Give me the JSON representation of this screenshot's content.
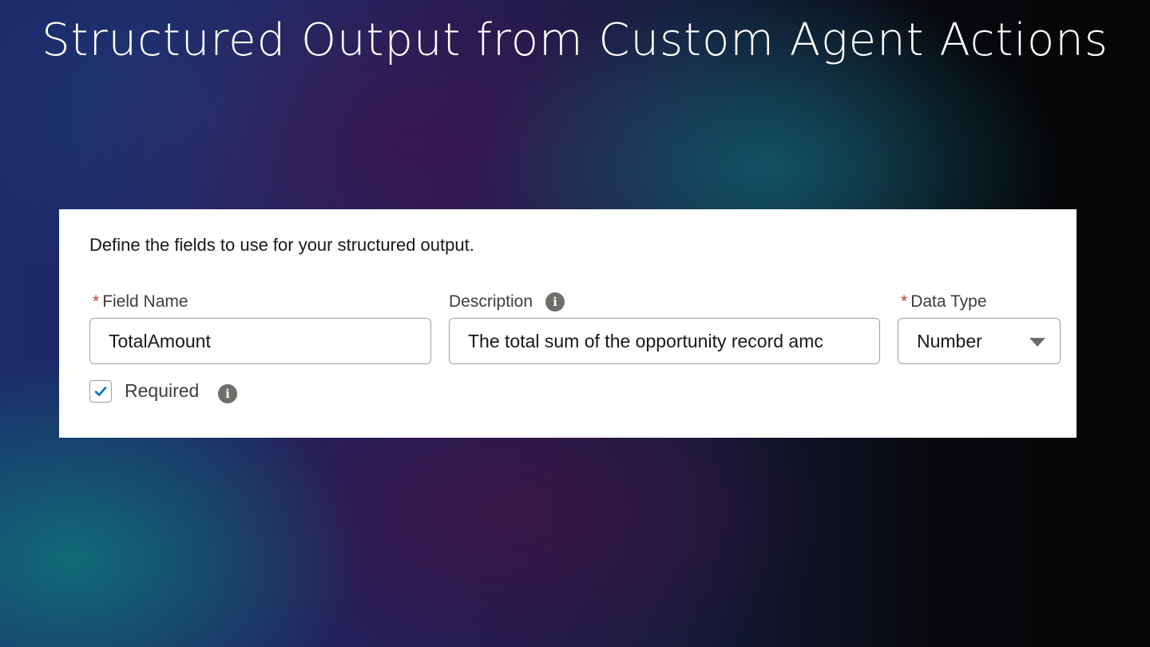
{
  "slide": {
    "title": "Structured Output from Custom Agent Actions"
  },
  "form": {
    "intro_text": "Define the fields to use for your structured output.",
    "field_name": {
      "required_marker": "*",
      "label": "Field Name",
      "value": "TotalAmount"
    },
    "description": {
      "label": "Description",
      "value": "The total sum of the opportunity record amc",
      "info_icon": "info-icon"
    },
    "data_type": {
      "required_marker": "*",
      "label": "Data Type",
      "selected_value": "Number",
      "dropdown_icon": "caret-down-icon"
    },
    "required_checkbox": {
      "label": "Required",
      "checked": true,
      "info_icon": "info-icon"
    }
  },
  "colors": {
    "required_star": "#c23934",
    "checkmark": "#0176d3",
    "info_icon_bg": "#706e6b",
    "panel_bg": "#ffffff"
  }
}
